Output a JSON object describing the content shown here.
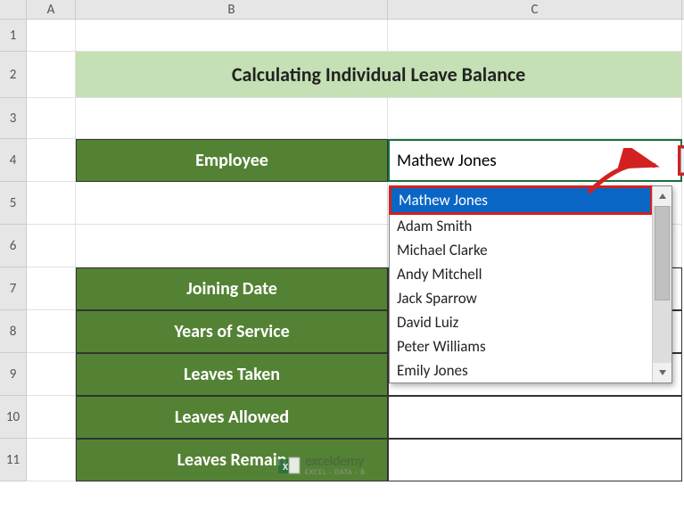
{
  "columns": [
    "A",
    "B",
    "C"
  ],
  "rows": [
    "1",
    "2",
    "3",
    "4",
    "5",
    "6",
    "7",
    "8",
    "9",
    "10",
    "11"
  ],
  "title": "Calculating Individual Leave Balance",
  "labels": {
    "employee": "Employee",
    "joining_date": "Joining Date",
    "years_service": "Years of Service",
    "leaves_taken": "Leaves Taken",
    "leaves_allowed": "Leaves Allowed",
    "leaves_remain": "Leaves Remain"
  },
  "employee_value": "Mathew Jones",
  "dropdown": {
    "items": [
      "Mathew Jones",
      "Adam Smith",
      "Michael Clarke",
      "Andy Mitchell",
      "Jack Sparrow",
      "David Luiz",
      "Peter Williams",
      "Emily Jones"
    ],
    "highlighted_index": 0
  },
  "watermark": {
    "main": "exceldemy",
    "sub": "EXCEL · DATA · B"
  }
}
